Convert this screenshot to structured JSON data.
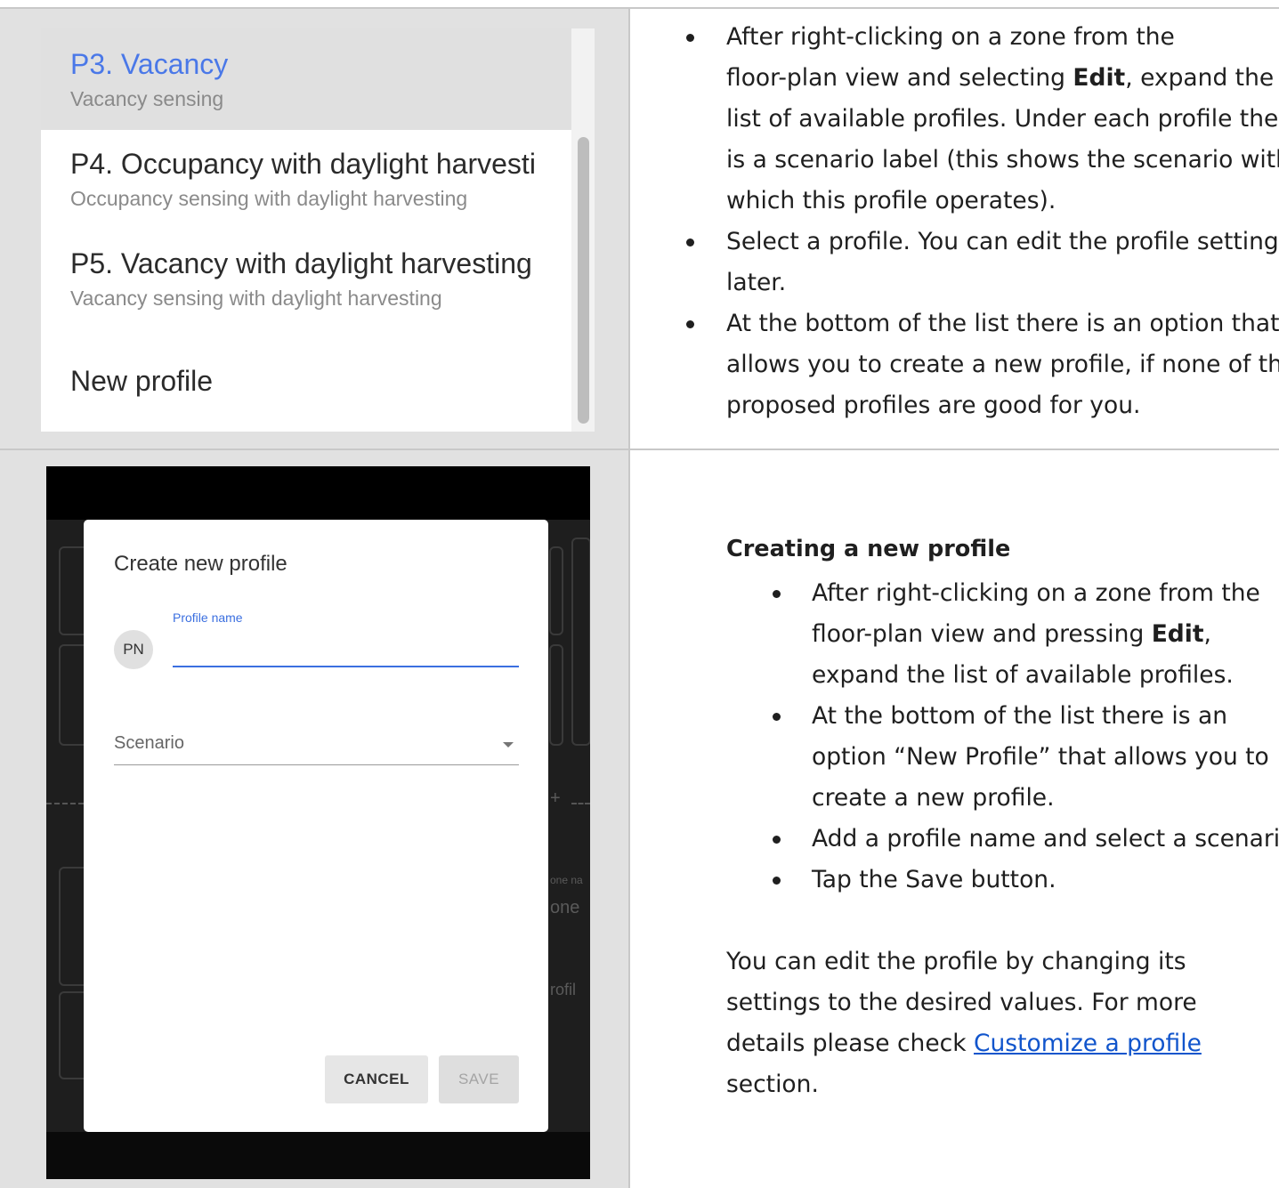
{
  "profile_list": {
    "items": [
      {
        "title": "P3. Vacancy",
        "subtitle": "Vacancy sensing"
      },
      {
        "title": "P4. Occupancy with daylight harvesti",
        "subtitle": "Occupancy sensing with daylight harvesting"
      },
      {
        "title": "P5. Vacancy with daylight harvesting",
        "subtitle": "Vacancy sensing with daylight harvesting"
      }
    ],
    "new_profile": "New profile"
  },
  "intro": {
    "b1_l1": "After right-clicking on a zone from the",
    "b1_l2_pre": "floor-plan view and selecting ",
    "b1_l2_bold": "Edit",
    "b1_l2_post": ", expand the",
    "b1_l3": "list of available profiles. Under each profile there",
    "b1_l4": "is a scenario label (this shows the scenario with",
    "b1_l5": "which this profile operates).",
    "b2_l1": "Select a profile. You can edit the profile settings",
    "b2_l2": "later.",
    "b3_l1": "At the bottom of the list there is an option that",
    "b3_l2": "allows you to create a new profile, if none of the",
    "b3_l3": "proposed profiles are good for you."
  },
  "dialog": {
    "title": "Create new profile",
    "avatar": "PN",
    "name_label": "Profile name",
    "scenario_label": "Scenario",
    "cancel": "CANCEL",
    "save": "SAVE"
  },
  "background_fragments": {
    "zone_label": "one na",
    "zone_value": "one",
    "profile": "rofil",
    "plus": "+"
  },
  "creating": {
    "heading": "Creating a new profile",
    "b1_l1": "After right-clicking on a zone from the",
    "b1_l2_pre": "floor-plan view and pressing ",
    "b1_l2_bold": "Edit",
    "b1_l2_post": ",",
    "b1_l3": "expand the list of available profiles.",
    "b2_l1": "At the bottom of the list there is an",
    "b2_l2": "option “New Profile” that allows you to",
    "b2_l3": "create a new profile.",
    "b3": "Add a profile name and select a scenario.",
    "b4": "Tap the Save button.",
    "p_l1": "You can edit the profile by changing its",
    "p_l2": "settings to the desired values. For more",
    "p_l3_pre": "details please check ",
    "p_l3_link": "Customize a profile",
    "p_l4": "section."
  }
}
